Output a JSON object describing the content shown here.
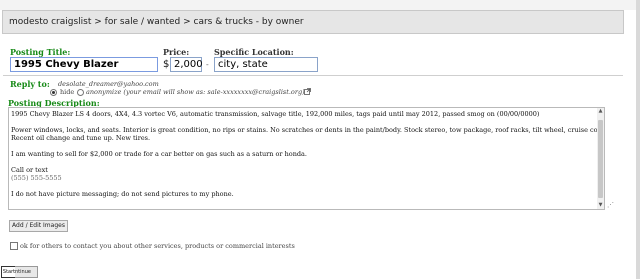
{
  "breadcrumb": "modesto craigslist > for sale / wanted > cars & trucks - by owner",
  "posting_title": {
    "label": "Posting Title:",
    "value": "1995 Chevy Blazer"
  },
  "price": {
    "label": "Price:",
    "currency": "$",
    "value": "2,000"
  },
  "dash": "-",
  "location": {
    "label": "Specific Location:",
    "value": "city, state"
  },
  "reply": {
    "label": "Reply to:",
    "email": "desolate_dreamer@yahoo.com",
    "option_hide": "hide",
    "option_anonymize": "anonymize (your email will show as: sale-xxxxxxxx@craigslist.org)",
    "help_icon": "external-link-icon"
  },
  "description": {
    "label": "Posting Description:",
    "lines": [
      "1995 Chevy Blazer LS 4 doors, 4X4, 4.3 vortec V6, automatic transmission, salvage title, 192,000 miles, tags paid until may 2012, passed smog on (00/00/0000)",
      "",
      "Power windows, locks, and seats. Interior is great condition, no rips or stains. No scratches or dents in the paint/body. Stock stereo, tow package, roof racks, tilt wheel, cruise control.",
      "Recent oil change and tune up. New tires.",
      "",
      "I am wanting to sell for $2,000 or trade for a car better on gas such as a saturn or honda.",
      "",
      "Call or text",
      "(555) 555-5555",
      "",
      "I do not have picture messaging; do not send pictures to my phone."
    ]
  },
  "add_images_button": "Add / Edit Images",
  "ok_contact_label": "ok for others to contact you about other services, products or commercial interests",
  "start_label": "Start",
  "continue_label": "ntinue"
}
